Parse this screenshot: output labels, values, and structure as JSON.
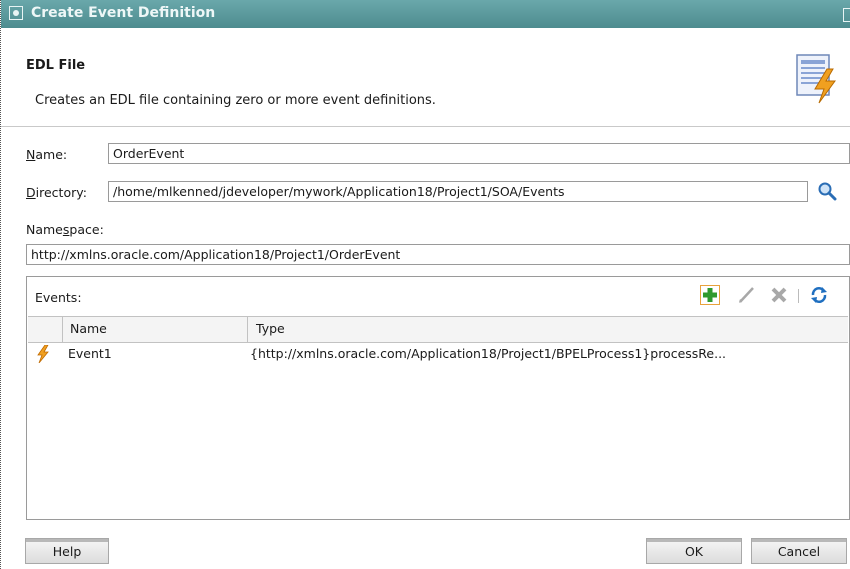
{
  "window": {
    "title": "Create Event Definition"
  },
  "header": {
    "title": "EDL File",
    "description": "Creates an EDL file containing zero or more event definitions.",
    "icon": "edl-file-icon"
  },
  "form": {
    "name_label_u": "N",
    "name_label_rest": "ame:",
    "name_value": "OrderEvent",
    "directory_label_u": "D",
    "directory_label_rest": "irectory:",
    "directory_value": "/home/mlkenned/jdeveloper/mywork/Application18/Project1/SOA/Events",
    "namespace_label_pre": "Name",
    "namespace_label_u": "s",
    "namespace_label_rest": "pace:",
    "namespace_value": "http://xmlns.oracle.com/Application18/Project1/OrderEvent"
  },
  "events": {
    "label": "Events:",
    "columns": [
      "Name",
      "Type"
    ],
    "rows": [
      {
        "name": "Event1",
        "type": "{http://xmlns.oracle.com/Application18/Project1/BPELProcess1}processRe..."
      }
    ],
    "toolbar_icons": [
      "add-icon",
      "edit-icon",
      "delete-icon",
      "refresh-icon"
    ]
  },
  "buttons": {
    "help": "Help",
    "ok": "OK",
    "cancel": "Cancel"
  },
  "colors": {
    "titlebar": "#5f9ea1",
    "accent_orange": "#e8a23c"
  }
}
